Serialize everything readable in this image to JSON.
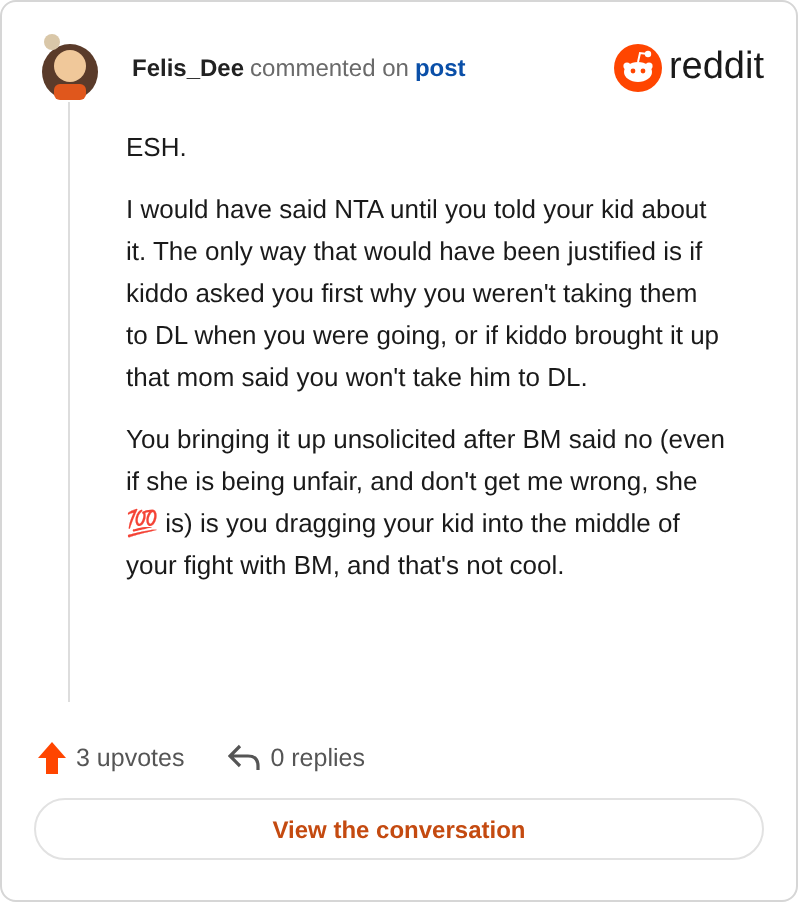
{
  "header": {
    "author": "Felis_Dee",
    "action": "commented on",
    "link": "post",
    "brand": "reddit"
  },
  "paragraphs": [
    "ESH.",
    "I would have said NTA until you told your kid about it. The only way that would have been justified is if kiddo asked you first why you weren't taking them to DL when you were going, or if kiddo brought it up that mom said you won't take him to DL.",
    "You bringing it up unsolicited after BM said no (even if she is being unfair, and don't get me wrong, she 💯 is) is you dragging your kid into the middle of your fight with BM, and that's not cool."
  ],
  "stats": {
    "upvotes": "3 upvotes",
    "replies": "0 replies"
  },
  "button": "View the conversation"
}
